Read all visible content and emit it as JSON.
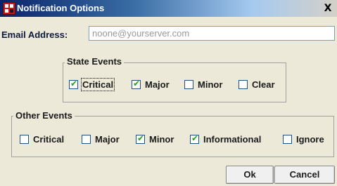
{
  "window": {
    "title": "Notification Options",
    "close_glyph": "X"
  },
  "email": {
    "label": "Email Address:",
    "value": "noone@yourserver.com"
  },
  "state_events": {
    "title": "State Events",
    "items": [
      {
        "label": "Critical",
        "checked": true,
        "focused": true
      },
      {
        "label": "Major",
        "checked": true
      },
      {
        "label": "Minor",
        "checked": false
      },
      {
        "label": "Clear",
        "checked": false
      }
    ]
  },
  "other_events": {
    "title": "Other Events",
    "items": [
      {
        "label": "Critical",
        "checked": false
      },
      {
        "label": "Major",
        "checked": false
      },
      {
        "label": "Minor",
        "checked": true
      },
      {
        "label": "Informational",
        "checked": true
      },
      {
        "label": "Ignore",
        "checked": false
      }
    ]
  },
  "buttons": {
    "ok": "Ok",
    "cancel": "Cancel"
  },
  "colors": {
    "titlebar_start": "#0a246a",
    "checkmark": "#21a121",
    "background": "#ece9d8"
  }
}
